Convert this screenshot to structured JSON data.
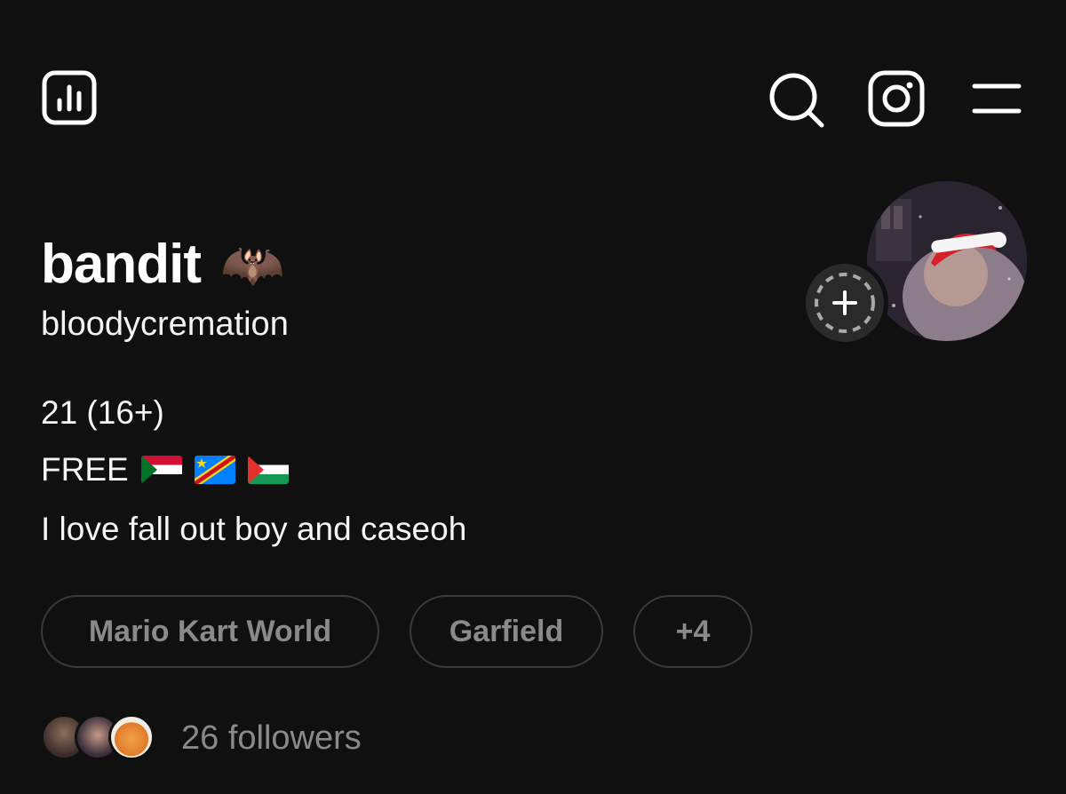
{
  "topbar": {
    "icons": [
      "insights-icon",
      "search-icon",
      "instagram-icon",
      "menu-icon"
    ]
  },
  "profile": {
    "display_name": "bandit",
    "name_emoji": "🦇",
    "username": "bloodycremation"
  },
  "bio": {
    "line1": "21 (16+)",
    "line2_prefix": "FREE",
    "flags": [
      "sudan-flag",
      "dr-congo-flag",
      "palestine-flag"
    ],
    "line3": "I love fall out boy and caseoh"
  },
  "tags": [
    "Mario Kart World",
    "Garfield",
    "+4"
  ],
  "followers": {
    "label": "26 followers"
  },
  "colors": {
    "background": "#101010",
    "text": "#f5f5f5",
    "muted": "#8a8a8a",
    "pill_border": "#3a3a3a"
  }
}
